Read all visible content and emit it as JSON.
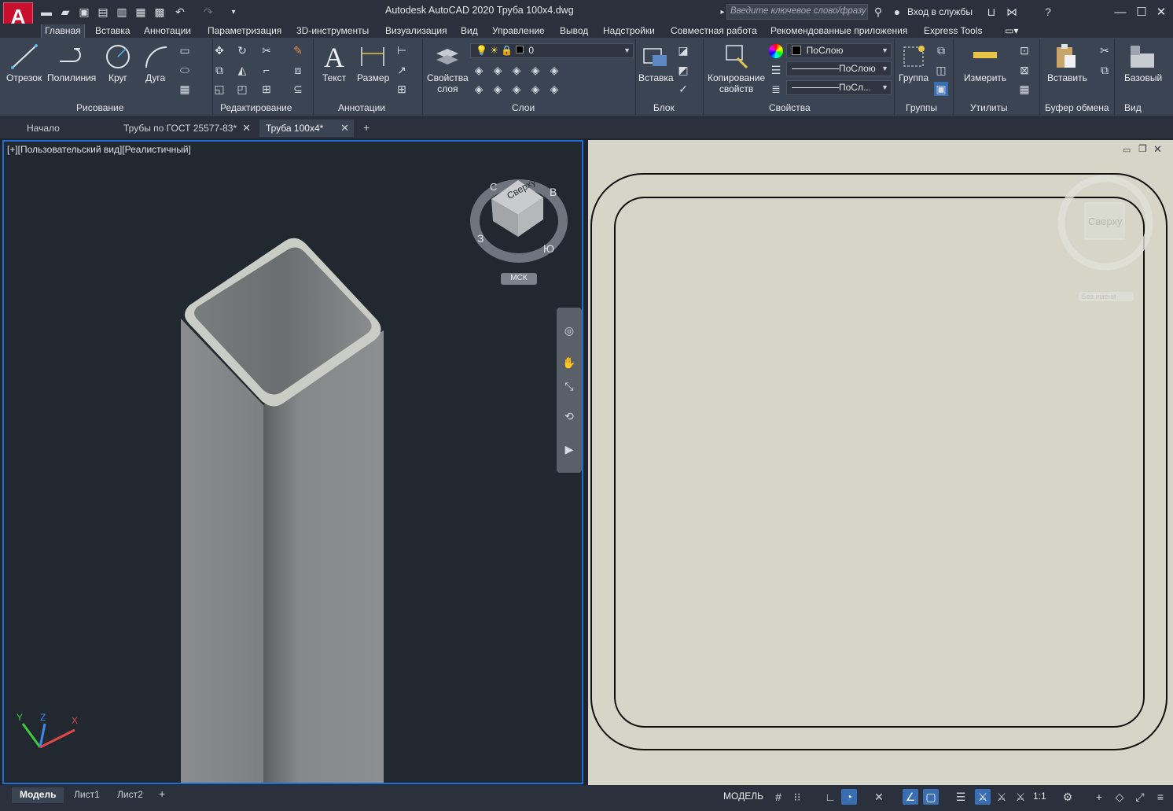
{
  "app": {
    "logo_letter": "A",
    "title": "Autodesk AutoCAD 2020    Труба 100x4.dwg"
  },
  "search": {
    "placeholder": "Введите ключевое слово/фразу"
  },
  "account": {
    "sign_in": "Вход в службы"
  },
  "ribbon_tabs": [
    "Главная",
    "Вставка",
    "Аннотации",
    "Параметризация",
    "3D-инструменты",
    "Визуализация",
    "Вид",
    "Управление",
    "Вывод",
    "Надстройки",
    "Совместная работа",
    "Рекомендованные приложения",
    "Express Tools"
  ],
  "ribbon": {
    "draw": {
      "line": "Отрезок",
      "polyline": "Полилиния",
      "circle": "Круг",
      "arc": "Дуга",
      "panel": "Рисование"
    },
    "modify": {
      "panel": "Редактирование"
    },
    "annotation": {
      "text": "Текст",
      "dimension": "Размер",
      "panel": "Аннотации"
    },
    "layers": {
      "properties_line1": "Свойства",
      "properties_line2": "слоя",
      "current_layer": "0",
      "panel": "Слои"
    },
    "block": {
      "insert": "Вставка",
      "panel": "Блок"
    },
    "properties": {
      "match_line1": "Копирование",
      "match_line2": "свойств",
      "color": "ПоСлою",
      "linetype": "ПоСлою",
      "lineweight": "ПоСл...",
      "panel": "Свойства"
    },
    "groups": {
      "group": "Группа",
      "panel": "Группы"
    },
    "utilities": {
      "measure": "Измерить",
      "panel": "Утилиты"
    },
    "clipboard": {
      "paste": "Вставить",
      "panel": "Буфер обмена"
    },
    "view": {
      "base": "Базовый",
      "panel": "Вид"
    }
  },
  "doc_tabs": {
    "start": "Начало",
    "tab1": "Трубы по ГОСТ 25577-83*",
    "tab2": "Труба 100x4*"
  },
  "viewport_left": {
    "label": "[+][Пользовательский вид][Реалистичный]",
    "cube_top": "Сверху",
    "compass_n": "С",
    "compass_e": "В",
    "compass_w": "З",
    "compass_s": "Ю",
    "ucs": "МСК"
  },
  "viewport_right": {
    "cube_top": "Сверху",
    "ucs": "Без имени"
  },
  "layout_tabs": [
    "Модель",
    "Лист1",
    "Лист2"
  ],
  "status": {
    "model": "МОДЕЛЬ",
    "scale": "1:1"
  },
  "colors": {
    "accent": "#1f6ed4",
    "ribbon_bg": "#3b4453",
    "titlebar_bg": "#2b313c",
    "drawing_bg": "#d5d6c8"
  }
}
